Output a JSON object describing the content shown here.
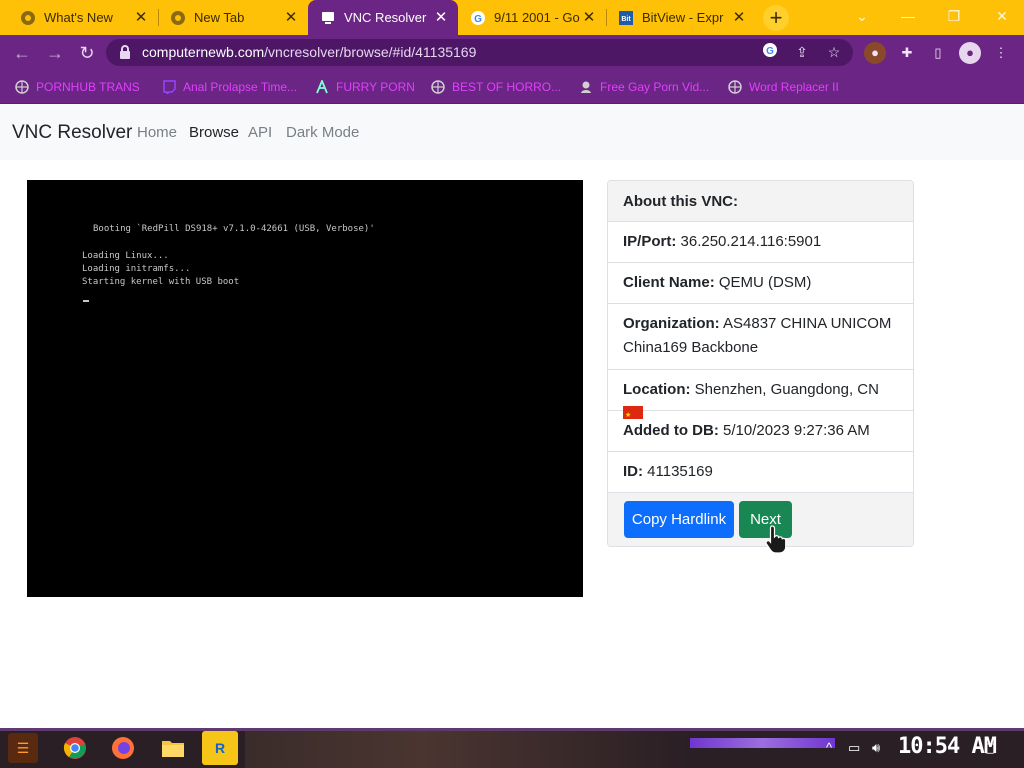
{
  "browser": {
    "tabs": [
      {
        "title": "What's New",
        "icon": "chrome-icon",
        "active": false
      },
      {
        "title": "New Tab",
        "icon": "chrome-icon",
        "active": false
      },
      {
        "title": "VNC Resolver",
        "icon": "vnc-icon",
        "active": true
      },
      {
        "title": "9/11 2001 - Go",
        "icon": "google-icon",
        "active": false
      },
      {
        "title": "BitView - Expr",
        "icon": "bitview-icon",
        "active": false
      }
    ],
    "new_tab_label": "+",
    "url_host": "computernewb.com",
    "url_path": "/vncresolver/browse/#id/41135169",
    "bookmarks": [
      {
        "label": "PORNHUB TRANS",
        "icon": "globe-icon"
      },
      {
        "label": "Anal Prolapse Time...",
        "icon": "twitch-icon"
      },
      {
        "label": "FURRY PORN",
        "icon": "logo-icon"
      },
      {
        "label": "BEST OF HORRO...",
        "icon": "globe-icon"
      },
      {
        "label": "Free Gay Porn Vid...",
        "icon": "site-icon"
      },
      {
        "label": "Word Replacer II",
        "icon": "globe-icon"
      }
    ]
  },
  "site": {
    "brand": "VNC Resolver",
    "nav": [
      "Home",
      "Browse",
      "API",
      "Dark Mode"
    ],
    "active_nav": "Browse"
  },
  "screen": {
    "line1": "Booting `RedPill DS918+ v7.1.0-42661 (USB, Verbose)'",
    "line2": "Loading Linux...",
    "line3": "Loading initramfs...",
    "line4": "Starting kernel with USB boot"
  },
  "info": {
    "header": "About this VNC:",
    "ip_label": "IP/Port:",
    "ip_value": "36.250.214.116:5901",
    "client_label": "Client Name:",
    "client_value": "QEMU (DSM)",
    "org_label": "Organization:",
    "org_value_1": "AS4837 CHINA UNICOM",
    "org_value_2": "China169 Backbone",
    "loc_label": "Location:",
    "loc_value": "Shenzhen, Guangdong, CN",
    "added_label": "Added to DB:",
    "added_value": "5/10/2023 9:27:36 AM",
    "id_label": "ID:",
    "id_value": "41135169",
    "copy_button": "Copy Hardlink",
    "next_button": "Next"
  },
  "taskbar": {
    "clock": "10:54 AM"
  },
  "colors": {
    "tab_strip": "#ffc107",
    "chrome_purple": "#6b2585",
    "bookmark_text": "#e040fb",
    "primary": "#0d6efd",
    "success": "#198754"
  }
}
